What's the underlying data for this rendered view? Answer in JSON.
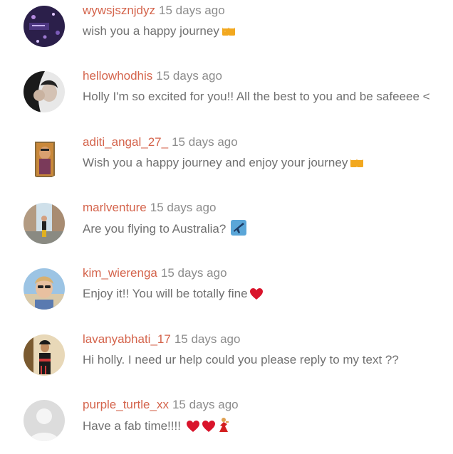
{
  "comments": [
    {
      "username": "wywsjsznjdyz",
      "time": "15 days ago",
      "text": "wish you a happy journey",
      "emojis": [
        "beer-mugs-icon"
      ]
    },
    {
      "username": "hellowhodhis",
      "time": "15 days ago",
      "text": "Holly I'm so excited for you!! All the best to you and be safeeee <",
      "emojis": []
    },
    {
      "username": "aditi_angal_27_",
      "time": "15 days ago",
      "text": "Wish you a happy journey and enjoy your journey",
      "emojis": [
        "beer-mugs-icon"
      ]
    },
    {
      "username": "marlventure",
      "time": "15 days ago",
      "text": "Are you flying to Australia? ",
      "emojis": [
        "airplane-icon"
      ]
    },
    {
      "username": "kim_wierenga",
      "time": "15 days ago",
      "text": "Enjoy it!! You will be totally fine",
      "emojis": [
        "red-heart-icon"
      ]
    },
    {
      "username": "lavanyabhati_17",
      "time": "15 days ago",
      "text": "Hi holly. I need ur help could you please reply to my text ??",
      "emojis": []
    },
    {
      "username": "purple_turtle_xx",
      "time": "15 days ago",
      "text": "Have a fab time!!!! ",
      "emojis": [
        "red-heart-icon",
        "red-heart-icon",
        "dancer-icon"
      ]
    }
  ],
  "colors": {
    "username": "#d4644c",
    "meta": "#8c8c8c",
    "body_text": "#707070"
  }
}
